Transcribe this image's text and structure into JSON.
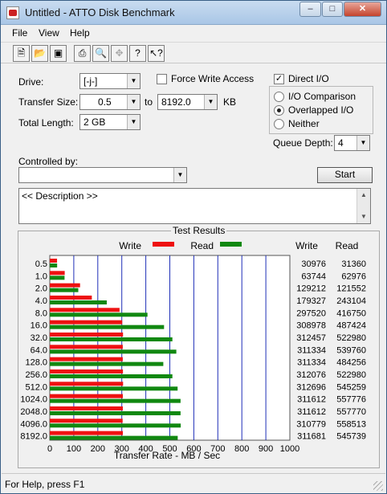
{
  "window": {
    "title": "Untitled - ATTO Disk Benchmark",
    "minimize_glyph": "–",
    "maximize_glyph": "□",
    "close_glyph": "✕"
  },
  "menu": {
    "items": [
      "File",
      "View",
      "Help"
    ]
  },
  "toolbar": {
    "icons": [
      "new-icon",
      "open-icon",
      "save-icon",
      "print-icon",
      "print-preview-icon",
      "move-icon",
      "help-icon",
      "context-help-icon"
    ]
  },
  "form": {
    "drive_label": "Drive:",
    "drive_value": "[-j-]",
    "force_write_label": "Force Write Access",
    "force_write_checked": false,
    "direct_io_label": "Direct I/O",
    "direct_io_checked": true,
    "transfer_size_label": "Transfer Size:",
    "transfer_from": "0.5",
    "to_label": "to",
    "transfer_to": "8192.0",
    "kb_label": "KB",
    "total_length_label": "Total Length:",
    "total_length_value": "2 GB",
    "radio_io_comparison": "I/O Comparison",
    "radio_overlapped": "Overlapped I/O",
    "radio_neither": "Neither",
    "selected_radio": "Overlapped I/O",
    "queue_depth_label": "Queue Depth:",
    "queue_depth_value": "4",
    "controlled_by_label": "Controlled by:",
    "controlled_by_value": "",
    "start_label": "Start",
    "description": "<< Description >>"
  },
  "results": {
    "title": "Test Results",
    "write_legend": "Write",
    "read_legend": "Read",
    "write_col": "Write",
    "read_col": "Read",
    "write_color": "#ee1111",
    "read_color": "#118811"
  },
  "chart_data": {
    "type": "bar",
    "orientation": "horizontal",
    "categories": [
      "0.5",
      "1.0",
      "2.0",
      "4.0",
      "8.0",
      "16.0",
      "32.0",
      "64.0",
      "128.0",
      "256.0",
      "512.0",
      "1024.0",
      "2048.0",
      "4096.0",
      "8192.0"
    ],
    "series": [
      {
        "name": "Write",
        "color": "#ee1111",
        "values": [
          30976,
          63744,
          129212,
          179327,
          297520,
          308978,
          312457,
          311334,
          311334,
          312076,
          312696,
          311612,
          311612,
          310779,
          311681
        ]
      },
      {
        "name": "Read",
        "color": "#118811",
        "values": [
          31360,
          62976,
          121552,
          243104,
          416750,
          487424,
          522980,
          539760,
          484256,
          522980,
          545259,
          557776,
          557770,
          558513,
          545739
        ]
      }
    ],
    "xlabel": "Transfer Rate - MB / Sec",
    "xticks": [
      "0",
      "100",
      "200",
      "300",
      "400",
      "500",
      "600",
      "700",
      "800",
      "900",
      "1000"
    ],
    "xlim": [
      0,
      1000
    ],
    "value_unit": "KB/sec",
    "grid": true
  },
  "status": {
    "text": "For Help, press F1"
  }
}
